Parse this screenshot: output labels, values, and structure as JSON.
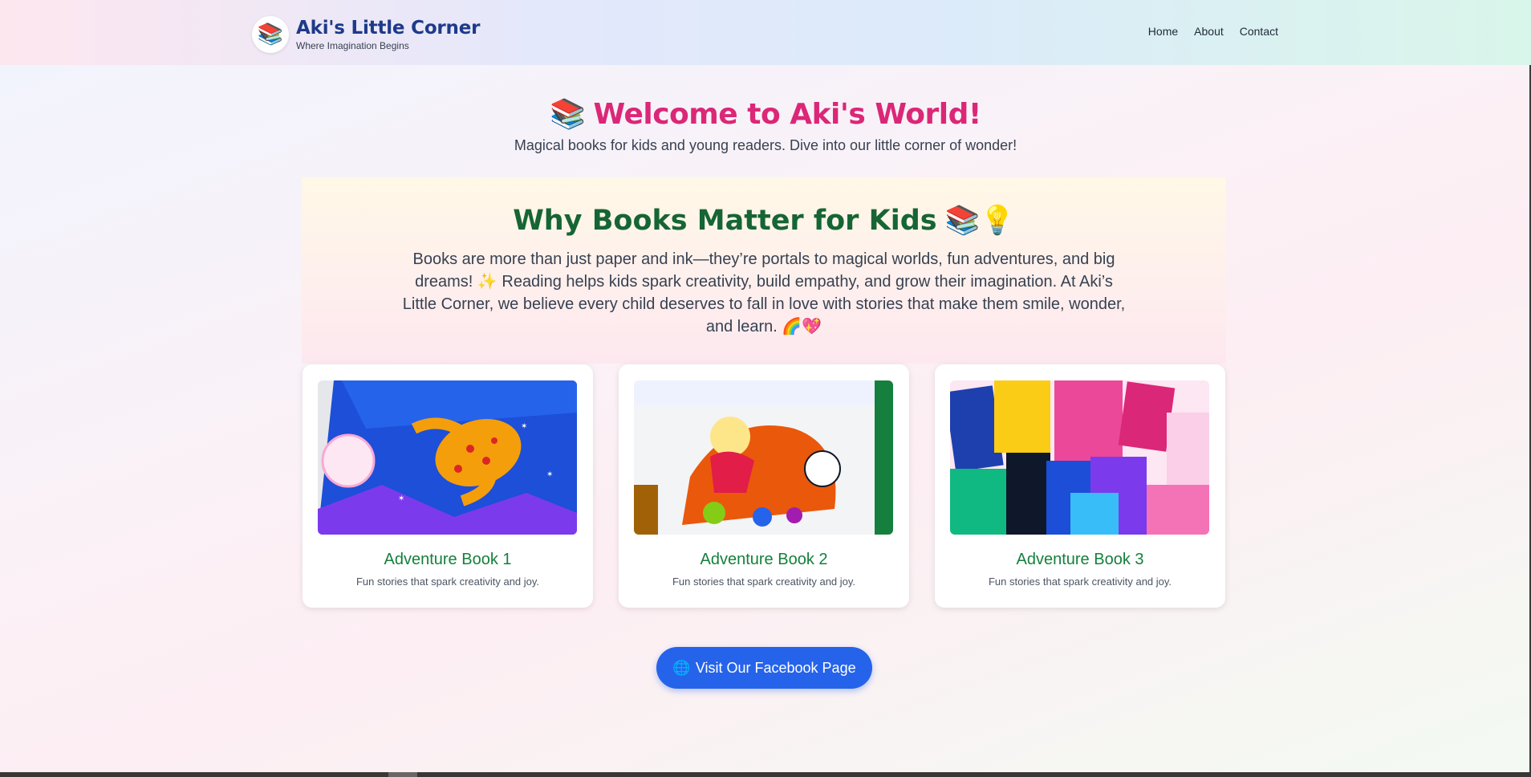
{
  "header": {
    "logo_icon": "books-icon",
    "logo_glyph": "📚",
    "title": "Aki's Little Corner",
    "tagline": "Where Imagination Begins",
    "nav": [
      {
        "label": "Home"
      },
      {
        "label": "About"
      },
      {
        "label": "Contact"
      }
    ]
  },
  "hero": {
    "title_icon": "books-icon",
    "title_glyph": "📚",
    "title": "Welcome to Aki's World!",
    "subtitle": "Magical books for kids and young readers. Dive into our little corner of wonder!"
  },
  "why": {
    "title": "Why Books Matter for Kids",
    "title_glyphs": "📚💡",
    "body": "Books are more than just paper and ink—they’re portals to magical worlds, fun adventures, and big dreams! ✨ Reading helps kids spark creativity, build empathy, and grow their imagination. At Aki’s Little Corner, we believe every child deserves to fall in love with stories that make them smile, wonder, and learn. 🌈💖"
  },
  "cards": [
    {
      "title": "Adventure Book 1",
      "desc": "Fun stories that spark creativity and joy."
    },
    {
      "title": "Adventure Book 2",
      "desc": "Fun stories that spark creativity and joy."
    },
    {
      "title": "Adventure Book 3",
      "desc": "Fun stories that spark creativity and joy."
    }
  ],
  "facebook_button": {
    "icon": "globe-icon",
    "glyph": "🌐",
    "label": "Visit Our Facebook Page"
  },
  "colors": {
    "brand_title": "#1e3a8a",
    "hero_title": "#db2777",
    "why_title": "#166534",
    "card_title": "#15803d",
    "button": "#2563eb"
  }
}
